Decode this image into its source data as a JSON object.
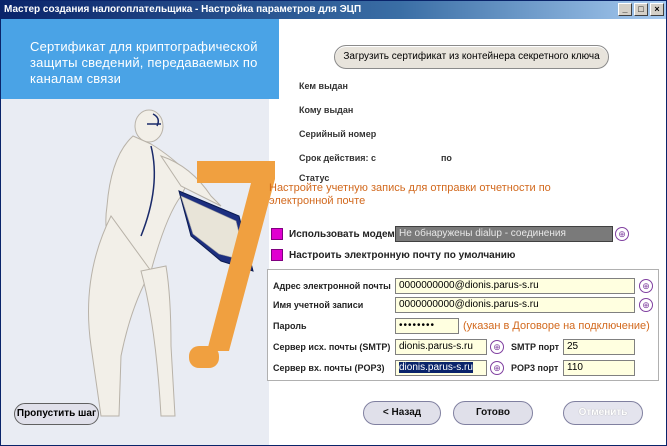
{
  "window": {
    "title": "Мастер создания налогоплательщика - Настройка параметров для ЭЦП",
    "min": "_",
    "max": "□",
    "close": "×"
  },
  "banner": {
    "text": "Сертификат для криптографической защиты сведений, передаваемых по каналам связи"
  },
  "graphic": {
    "number": "7."
  },
  "cert": {
    "load_button": "Загрузить сертификат из контейнера секретного ключа",
    "issued_by": "Кем выдан",
    "issued_to": "Кому выдан",
    "serial": "Серийный номер",
    "validity": "Срок действия: с",
    "validity_to": "по",
    "status": "Статус"
  },
  "account": {
    "heading": "Настройте учетную запись для отправки отчетности по электронной почте",
    "use_modem_label": "Использовать модем",
    "modem_value": "Не обнаружены dialup - соединения",
    "default_mail_label": "Настроить электронную почту по умолчанию"
  },
  "mail": {
    "email_label": "Адрес электронной почты",
    "email_value": "0000000000@dionis.parus-s.ru",
    "account_label": "Имя учетной записи",
    "account_value": "0000000000@dionis.parus-s.ru",
    "password_label": "Пароль",
    "password_value": "••••••••",
    "password_hint": "(указан в Договоре на подключение)",
    "smtp_label": "Сервер исх. почты (SMTP)",
    "smtp_value": "dionis.parus-s.ru",
    "smtp_port_label": "SMTP порт",
    "smtp_port_value": "25",
    "pop3_label": "Сервер вх. почты (POP3)",
    "pop3_value": "dionis.parus-s.ru",
    "pop3_port_label": "POP3 порт",
    "pop3_port_value": "110"
  },
  "nav": {
    "skip": "Пропустить шаг",
    "back": "< Назад",
    "done": "Готово",
    "cancel": "Отменить"
  },
  "colors": {
    "accent_blue": "#4aa3e6",
    "orange": "#d2691e",
    "magenta": "#e000d0",
    "field_bg": "#ffffe0"
  }
}
